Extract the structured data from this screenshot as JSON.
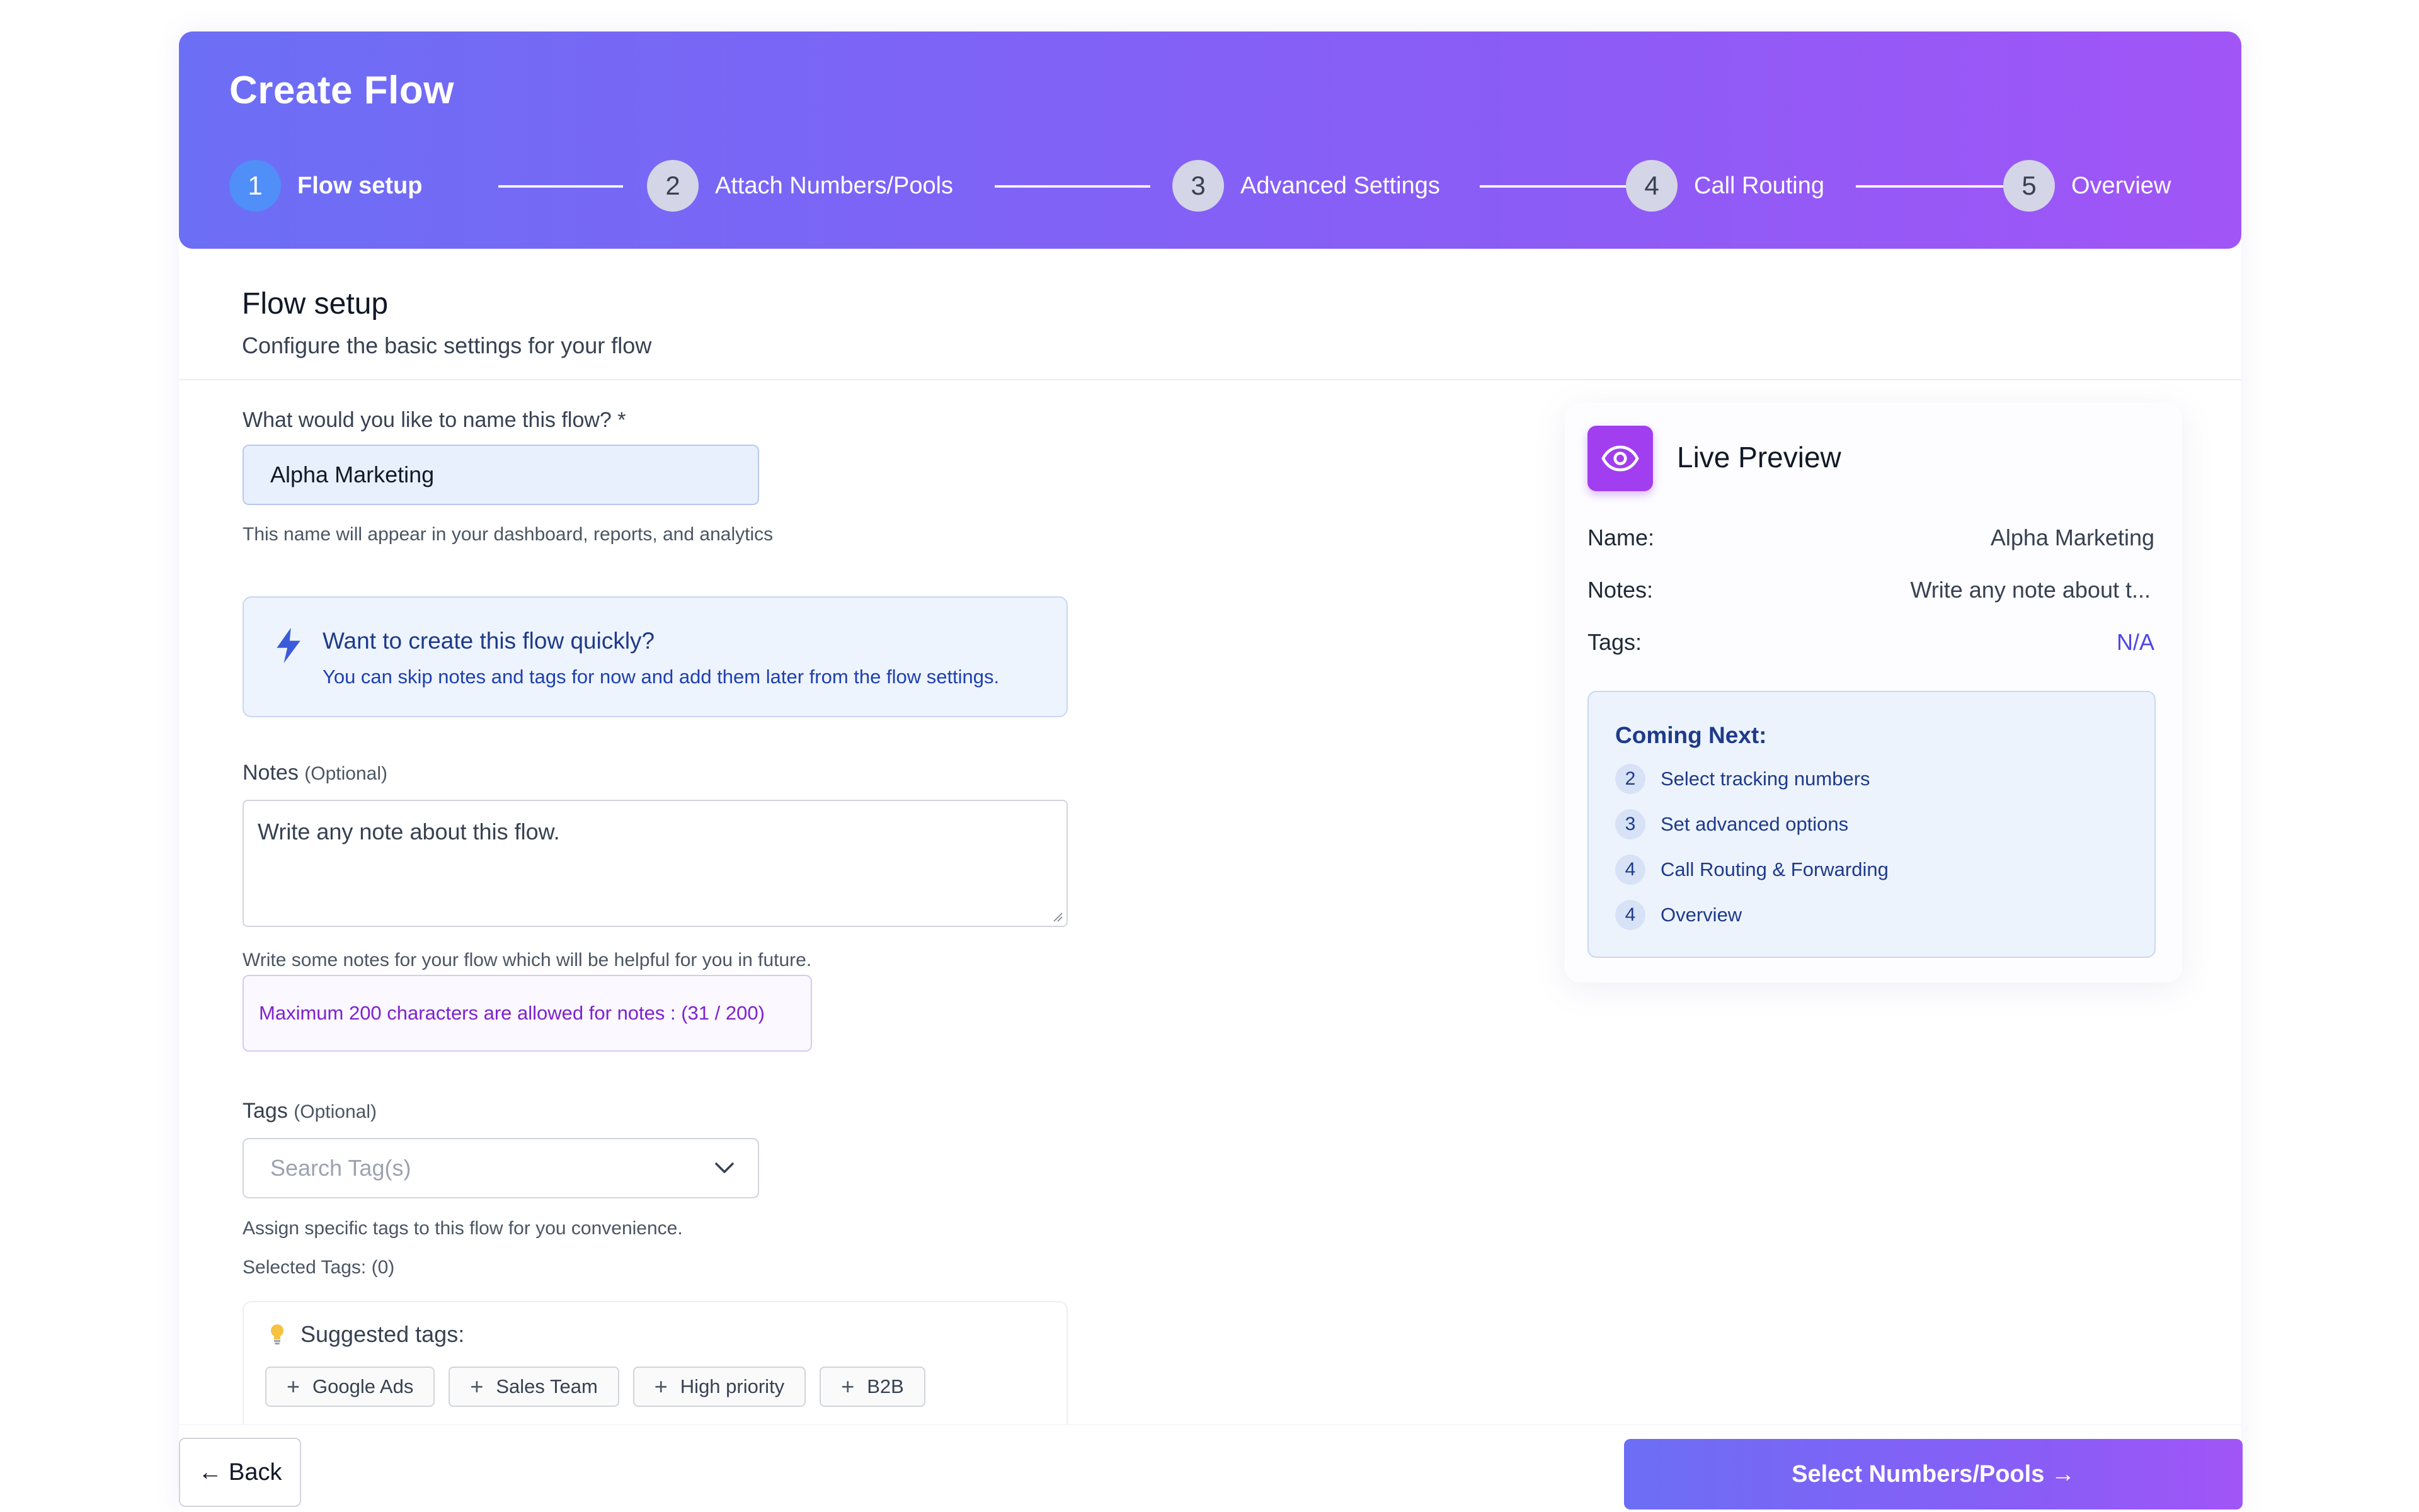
{
  "header": {
    "title": "Create Flow",
    "steps": [
      {
        "num": "1",
        "label": "Flow setup"
      },
      {
        "num": "2",
        "label": "Attach Numbers/Pools"
      },
      {
        "num": "3",
        "label": "Advanced Settings"
      },
      {
        "num": "4",
        "label": "Call Routing"
      },
      {
        "num": "5",
        "label": "Overview"
      }
    ],
    "active_step": 1
  },
  "section": {
    "title": "Flow setup",
    "subtitle": "Configure the basic settings for your flow"
  },
  "form": {
    "name": {
      "label": "What would you like to name this flow? *",
      "value": "Alpha Marketing",
      "helper": "This name will appear in your dashboard, reports, and analytics"
    },
    "tip": {
      "title": "Want to create this flow quickly?",
      "text": "You can skip notes and tags for now and add them later from the flow settings."
    },
    "notes": {
      "label": "Notes",
      "optional": "(Optional)",
      "value": "Write any note about this flow.",
      "helper": "Write some notes for your flow which will be helpful for you in future.",
      "limit_text": "Maximum 200 characters are allowed for notes : (31 / 200)"
    },
    "tags": {
      "label": "Tags",
      "optional": "(Optional)",
      "placeholder": "Search Tag(s)",
      "helper": "Assign specific tags to this flow for you convenience.",
      "selected": "Selected Tags: (0)"
    },
    "suggested": {
      "title": "Suggested tags:",
      "items": [
        "Google Ads",
        "Sales Team",
        "High priority",
        "B2B"
      ]
    }
  },
  "preview": {
    "title": "Live Preview",
    "name_label": "Name:",
    "name_value": "Alpha Marketing",
    "notes_label": "Notes:",
    "notes_value": "Write any note about t...",
    "tags_label": "Tags:",
    "tags_value": "N/A",
    "coming_next": {
      "title": "Coming Next:",
      "items": [
        {
          "num": "2",
          "label": "Select tracking numbers"
        },
        {
          "num": "3",
          "label": "Set advanced options"
        },
        {
          "num": "4",
          "label": "Call Routing & Forwarding"
        },
        {
          "num": "4",
          "label": "Overview"
        }
      ]
    }
  },
  "footer": {
    "back_label": "← Back",
    "next_label": "Select Numbers/Pools →"
  },
  "colors": {
    "accent_start": "#6c6ef5",
    "accent_end": "#a155f7",
    "active_step": "#4f8ff7",
    "preview_icon": "#a13ef0"
  }
}
